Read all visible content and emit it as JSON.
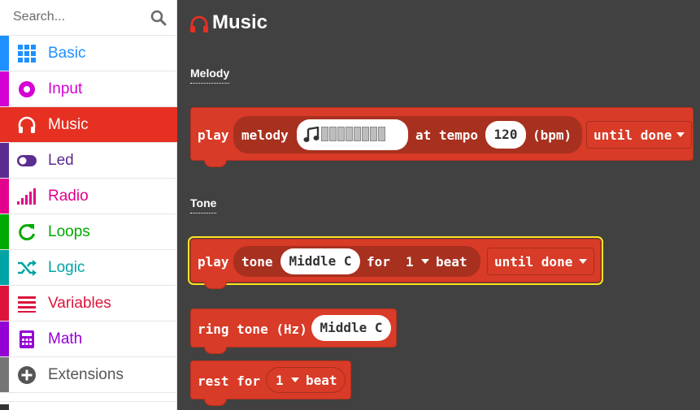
{
  "search": {
    "placeholder": "Search..."
  },
  "categories": [
    {
      "label": "Basic",
      "icon": "grid-icon",
      "color": "#1e90ff"
    },
    {
      "label": "Input",
      "icon": "record-icon",
      "color": "#d400d4"
    },
    {
      "label": "Music",
      "icon": "headphones-icon",
      "color": "#e63022",
      "selected": true
    },
    {
      "label": "Led",
      "icon": "toggle-icon",
      "color": "#5c2d91"
    },
    {
      "label": "Radio",
      "icon": "signal-icon",
      "color": "#e3008c"
    },
    {
      "label": "Loops",
      "icon": "refresh-icon",
      "color": "#00aa00"
    },
    {
      "label": "Logic",
      "icon": "shuffle-icon",
      "color": "#00a4a6"
    },
    {
      "label": "Variables",
      "icon": "list-icon",
      "color": "#dc143c"
    },
    {
      "label": "Math",
      "icon": "calculator-icon",
      "color": "#9400d3"
    },
    {
      "label": "Extensions",
      "icon": "plus-circle-icon",
      "color": "#757575"
    }
  ],
  "flyout": {
    "title": "Music",
    "sections": {
      "melody": "Melody",
      "tone": "Tone"
    }
  },
  "blocks": {
    "play_melody": {
      "play": "play",
      "melody": "melody",
      "at_tempo": "at tempo",
      "tempo": "120",
      "bpm": "(bpm)",
      "mode": "until done"
    },
    "play_tone": {
      "play": "play",
      "tone": "tone",
      "note": "Middle C",
      "for": "for",
      "beats": "1",
      "beat": "beat",
      "mode": "until done"
    },
    "ring_tone": {
      "label": "ring tone (Hz)",
      "note": "Middle C"
    },
    "rest": {
      "label": "rest for",
      "beats": "1",
      "beat": "beat"
    }
  }
}
